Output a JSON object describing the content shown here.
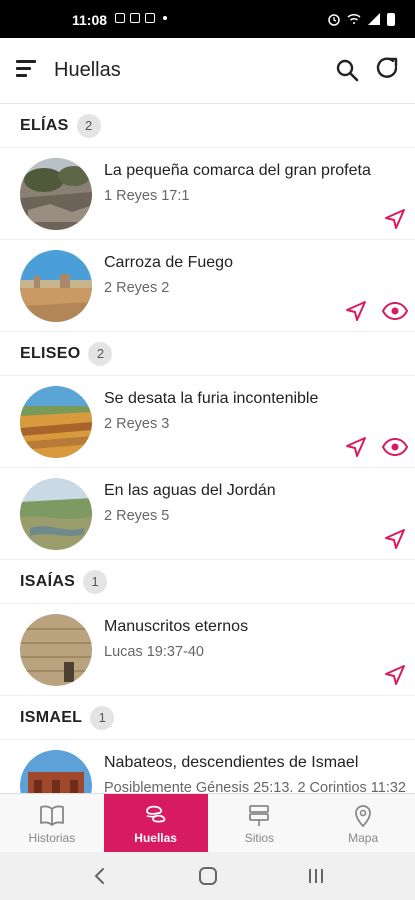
{
  "status_bar": {
    "time": "11:08"
  },
  "app_bar": {
    "title": "Huellas",
    "icons": [
      "menu-icon",
      "search-icon",
      "refresh-icon"
    ]
  },
  "accent_color": "#d81b60",
  "sections": [
    {
      "name": "ELÍAS",
      "count": "2",
      "items": [
        {
          "title": "La pequeña comarca del gran profeta",
          "ref": "1 Reyes 17:1",
          "actions": [
            "navigate"
          ]
        },
        {
          "title": "Carroza de Fuego",
          "ref": "2 Reyes 2",
          "actions": [
            "navigate",
            "view"
          ]
        }
      ]
    },
    {
      "name": "ELISEO",
      "count": "2",
      "items": [
        {
          "title": "Se desata la furia incontenible",
          "ref": "2 Reyes 3",
          "actions": [
            "navigate",
            "view"
          ]
        },
        {
          "title": "En las aguas del Jordán",
          "ref": "2 Reyes 5",
          "actions": [
            "navigate"
          ]
        }
      ]
    },
    {
      "name": "ISAÍAS",
      "count": "1",
      "items": [
        {
          "title": "Manuscritos eternos",
          "ref": "Lucas 19:37-40",
          "actions": [
            "navigate"
          ]
        }
      ]
    },
    {
      "name": "ISMAEL",
      "count": "1",
      "items": [
        {
          "title": "Nabateos, descendientes de Ismael",
          "ref": "Posiblemente Génesis 25:13. 2 Corintios 11:32",
          "actions": [
            "navigate"
          ]
        }
      ]
    }
  ],
  "tabs": [
    {
      "label": "Historias",
      "icon": "book-icon",
      "active": false
    },
    {
      "label": "Huellas",
      "icon": "footprints-icon",
      "active": true
    },
    {
      "label": "Sitios",
      "icon": "signpost-icon",
      "active": false
    },
    {
      "label": "Mapa",
      "icon": "map-pin-icon",
      "active": false
    }
  ]
}
